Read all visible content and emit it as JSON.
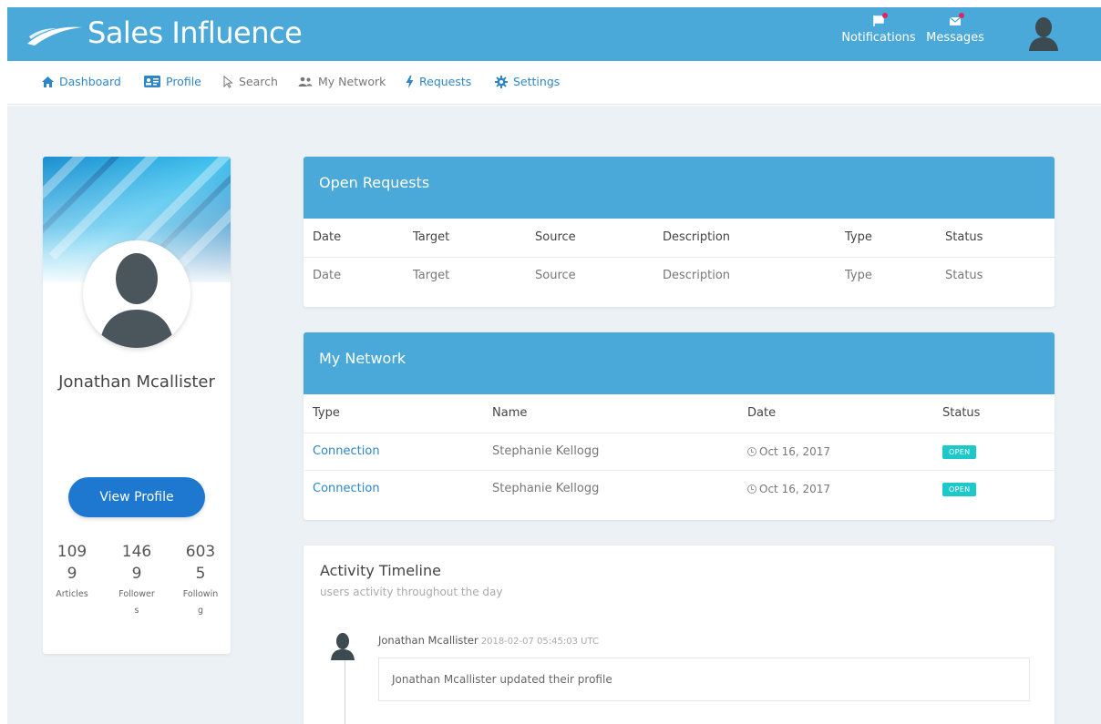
{
  "app": {
    "title": "Sales Influence",
    "colors": {
      "header": "#4aa9d8",
      "accent": "#2f86c6",
      "button": "#1e78d0",
      "badge": "#1fc8c8",
      "background": "#ebf1f5"
    }
  },
  "topnav": {
    "notifications_label": "Notifications",
    "messages_label": "Messages",
    "notifications_icon": "flag-icon",
    "messages_icon": "envelope-icon"
  },
  "subnav": {
    "items": [
      {
        "label": "Dashboard",
        "icon": "home-icon"
      },
      {
        "label": "Profile",
        "icon": "id-card-icon"
      },
      {
        "label": "Search",
        "icon": "cursor-icon"
      },
      {
        "label": "My Network",
        "icon": "users-icon"
      },
      {
        "label": "Requests",
        "icon": "bolt-icon"
      },
      {
        "label": "Settings",
        "icon": "gear-icon"
      }
    ]
  },
  "profile": {
    "name": "Jonathan Mcallister",
    "view_profile_label": "View Profile",
    "stats": [
      {
        "value": "1099",
        "label": "Articles"
      },
      {
        "value": "1469",
        "label": "Followers"
      },
      {
        "value": "6035",
        "label": "Following"
      }
    ]
  },
  "open_requests": {
    "title": "Open Requests",
    "columns": [
      "Date",
      "Target",
      "Source",
      "Description",
      "Type",
      "Status"
    ],
    "rows": [
      [
        "Date",
        "Target",
        "Source",
        "Description",
        "Type",
        "Status"
      ]
    ]
  },
  "my_network": {
    "title": "My Network",
    "columns": [
      "Type",
      "Name",
      "Date",
      "Status"
    ],
    "rows": [
      {
        "type": "Connection",
        "name": "Stephanie Kellogg",
        "date": "Oct 16, 2017",
        "status": "OPEN"
      },
      {
        "type": "Connection",
        "name": "Stephanie Kellogg",
        "date": "Oct 16, 2017",
        "status": "OPEN"
      }
    ]
  },
  "activity": {
    "title": "Activity Timeline",
    "subtitle": "users activity throughout the day",
    "entries": [
      {
        "author": "Jonathan Mcallister",
        "time": "2018-02-07 05:45:03 UTC",
        "text": "Jonathan Mcallister updated their profile"
      }
    ]
  }
}
